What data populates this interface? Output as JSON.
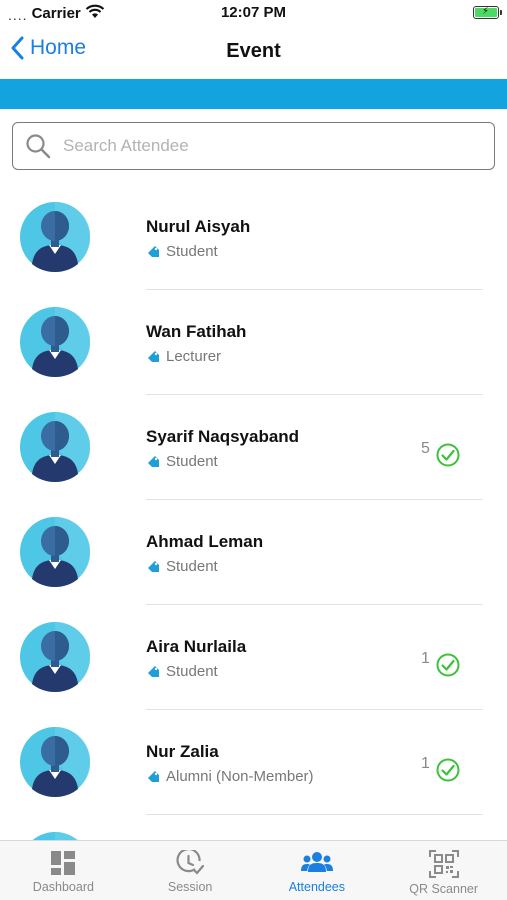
{
  "status_bar": {
    "signal": "....",
    "carrier": "Carrier",
    "time": "12:07 PM",
    "battery_color": "#4cd964"
  },
  "nav": {
    "back_label": "Home",
    "title": "Event",
    "accent_color": "#1a7fe0",
    "band_color": "#13a4e0"
  },
  "search": {
    "placeholder": "Search Attendee",
    "value": ""
  },
  "attendees": [
    {
      "name": "Nurul Aisyah",
      "role": "Student",
      "count": "",
      "checked_in": false
    },
    {
      "name": "Wan Fatihah",
      "role": "Lecturer",
      "count": "",
      "checked_in": false
    },
    {
      "name": "Syarif Naqsyaband",
      "role": "Student",
      "count": "5",
      "checked_in": true
    },
    {
      "name": "Ahmad Leman",
      "role": "Student",
      "count": "",
      "checked_in": false
    },
    {
      "name": "Aira Nurlaila",
      "role": "Student",
      "count": "1",
      "checked_in": true
    },
    {
      "name": "Nur Zalia",
      "role": "Alumni (Non-Member)",
      "count": "1",
      "checked_in": true
    },
    {
      "name": "",
      "role": "",
      "count": "",
      "checked_in": false
    }
  ],
  "tabs": [
    {
      "label": "Dashboard",
      "icon": "dashboard-icon",
      "active": false
    },
    {
      "label": "Session",
      "icon": "clock-check-icon",
      "active": false
    },
    {
      "label": "Attendees",
      "icon": "people-icon",
      "active": true
    },
    {
      "label": "QR Scanner",
      "icon": "qr-code-icon",
      "active": false
    }
  ]
}
